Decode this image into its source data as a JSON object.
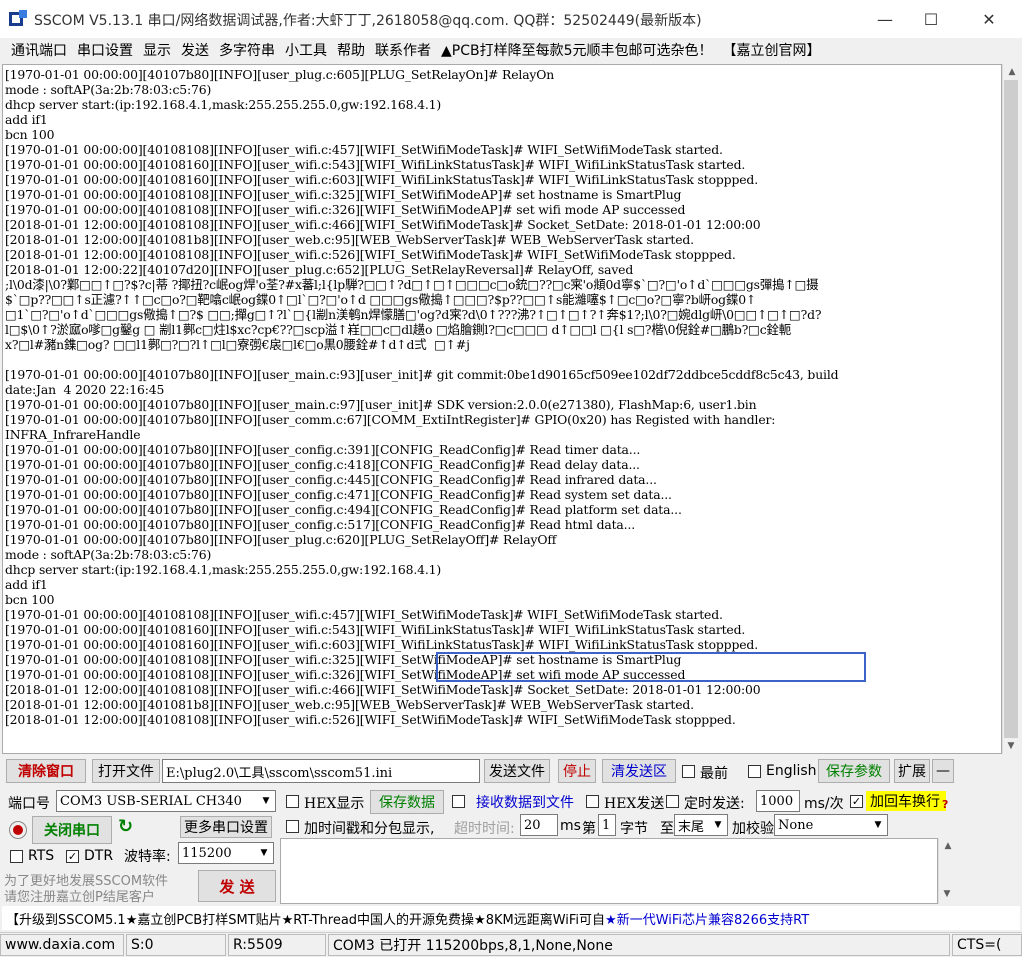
{
  "window": {
    "title": "SSCOM V5.13.1 串口/网络数据调试器,作者:大虾丁丁,2618058@qq.com. QQ群：52502449(最新版本)",
    "minimize_glyph": "—",
    "maximize_glyph": "☐",
    "close_glyph": "✕"
  },
  "menu": {
    "items": [
      "通讯端口",
      "串口设置",
      "显示",
      "发送",
      "多字符串",
      "小工具",
      "帮助",
      "联系作者",
      "▲PCB打样降至每款5元顺丰包邮可选杂色！",
      "【嘉立创官网】"
    ]
  },
  "terminal": {
    "lines": [
      "[1970-01-01 00:00:00][40107b80][INFO][user_plug.c:605][PLUG_SetRelayOn]# RelayOn",
      "mode : softAP(3a:2b:78:03:c5:76)",
      "dhcp server start:(ip:192.168.4.1,mask:255.255.255.0,gw:192.168.4.1)",
      "add if1",
      "bcn 100",
      "[1970-01-01 00:00:00][40108108][INFO][user_wifi.c:457][WIFI_SetWifiModeTask]# WIFI_SetWifiModeTask started.",
      "[1970-01-01 00:00:00][40108160][INFO][user_wifi.c:543][WIFI_WifiLinkStatusTask]# WIFI_WifiLinkStatusTask started.",
      "[1970-01-01 00:00:00][40108160][INFO][user_wifi.c:603][WIFI_WifiLinkStatusTask]# WIFI_WifiLinkStatusTask stoppped.",
      "[1970-01-01 00:00:00][40108108][INFO][user_wifi.c:325][WIFI_SetWifiModeAP]# set hostname is SmartPlug",
      "[1970-01-01 00:00:00][40108108][INFO][user_wifi.c:326][WIFI_SetWifiModeAP]# set wifi mode AP successed",
      "[2018-01-01 12:00:00][40108108][INFO][user_wifi.c:466][WIFI_SetWifiModeTask]# Socket_SetDate: 2018-01-01 12:00:00",
      "[2018-01-01 12:00:00][401081b8][INFO][user_web.c:95][WEB_WebServerTask]# WEB_WebServerTask started.",
      "[2018-01-01 12:00:00][40108108][INFO][user_wifi.c:526][WIFI_SetWifiModeTask]# WIFI_SetWifiModeTask stoppped.",
      "[2018-01-01 12:00:22][40107d20][INFO][user_plug.c:652][PLUG_SetRelayReversal]# RelayOff, saved",
      ";l\\0d漆|\\0?鄴□□↑□?$?c|蒂 ?揶扭?c岷og焊'o荃?#x蕃l;l{lp騨?□□↑?d□↑□↑□□□c□o銃□??□c宷'o頫0d寧$`□?□'o↑d`□□□gs彈搗↑□摄",
      "$`□p??□□↑s正濾?↑↑□c□o?□靶噏c岷og鍱0↑□l`□?□'o↑d □□□gs儆搗↑□□□?$p??□□↑s能濰噻$↑□c□o?□寧?b岍og鍱0↑",
      "□1`□?□'o↑d`□□□gs儆搗↑□?$ □□;撣g□↑?l`□{l剬n渼鹌n焊懞膳□'og?d宷?d\\0↑???沸?↑□↑□↑?↑奔$1?;l\\0?□婉dlg岍\\0□□↑□↑□?d?",
      "l□$\\0↑?淤寙o嗲□g鑿g □ 剬l1鄸c□炷l$xc?cp€??□scp溢↑嵀□□c□dl趪o □焰膾鍘l?□c□□□ d↑□□l □{l s□?楷\\0倪銓#□鵬b?□c銓軛",
      "x?□l#瀦n鏶□og? □□l1鄸□?□?l↑□l□寮彅€扆□l€□o黒0腰銓#↑d↑d弍  □↑#j",
      "",
      "[1970-01-01 00:00:00][40107b80][INFO][user_main.c:93][user_init]# git commit:0be1d90165cf509ee102df72ddbce5cddf8c5c43, build",
      "date:Jan  4 2020 22:16:45",
      "[1970-01-01 00:00:00][40107b80][INFO][user_main.c:97][user_init]# SDK version:2.0.0(e271380), FlashMap:6, user1.bin",
      "[1970-01-01 00:00:00][40107b80][INFO][user_comm.c:67][COMM_ExtiIntRegister]# GPIO(0x20) has Registed with handler:",
      "INFRA_InfrareHandle",
      "[1970-01-01 00:00:00][40107b80][INFO][user_config.c:391][CONFIG_ReadConfig]# Read timer data...",
      "[1970-01-01 00:00:00][40107b80][INFO][user_config.c:418][CONFIG_ReadConfig]# Read delay data...",
      "[1970-01-01 00:00:00][40107b80][INFO][user_config.c:445][CONFIG_ReadConfig]# Read infrared data...",
      "[1970-01-01 00:00:00][40107b80][INFO][user_config.c:471][CONFIG_ReadConfig]# Read system set data...",
      "[1970-01-01 00:00:00][40107b80][INFO][user_config.c:494][CONFIG_ReadConfig]# Read platform set data...",
      "[1970-01-01 00:00:00][40107b80][INFO][user_config.c:517][CONFIG_ReadConfig]# Read html data...",
      "[1970-01-01 00:00:00][40107b80][INFO][user_plug.c:620][PLUG_SetRelayOff]# RelayOff",
      "mode : softAP(3a:2b:78:03:c5:76)",
      "dhcp server start:(ip:192.168.4.1,mask:255.255.255.0,gw:192.168.4.1)",
      "add if1",
      "bcn 100",
      "[1970-01-01 00:00:00][40108108][INFO][user_wifi.c:457][WIFI_SetWifiModeTask]# WIFI_SetWifiModeTask started.",
      "[1970-01-01 00:00:00][40108160][INFO][user_wifi.c:543][WIFI_WifiLinkStatusTask]# WIFI_WifiLinkStatusTask started.",
      "[1970-01-01 00:00:00][40108160][INFO][user_wifi.c:603][WIFI_WifiLinkStatusTask]# WIFI_WifiLinkStatusTask stoppped.",
      "[1970-01-01 00:00:00][40108108][INFO][user_wifi.c:325][WIFI_SetWifiModeAP]# set hostname is SmartPlug",
      "[1970-01-01 00:00:00][40108108][INFO][user_wifi.c:326][WIFI_SetWifiModeAP]# set wifi mode AP successed",
      "[2018-01-01 12:00:00][40108108][INFO][user_wifi.c:466][WIFI_SetWifiModeTask]# Socket_SetDate: 2018-01-01 12:00:00",
      "[2018-01-01 12:00:00][401081b8][INFO][user_web.c:95][WEB_WebServerTask]# WEB_WebServerTask started.",
      "[2018-01-01 12:00:00][40108108][INFO][user_wifi.c:526][WIFI_SetWifiModeTask]# WIFI_SetWifiModeTask stoppped."
    ]
  },
  "toolbar1": {
    "clear_window": "清除窗口",
    "open_file": "打开文件",
    "file_path": "E:\\plug2.0\\工具\\sscom\\sscom51.ini",
    "send_file": "发送文件",
    "stop": "停止",
    "clear_send": "清发送区",
    "topmost": "最前",
    "english": "English",
    "save_params": "保存参数",
    "expand": "扩展",
    "collapse": "—"
  },
  "toolbar2": {
    "port_label": "端口号",
    "port_value": "COM3 USB-SERIAL CH340",
    "hex_display": "HEX显示",
    "save_data": "保存数据",
    "receive_to_file": "接收数据到文件",
    "hex_send": "HEX发送",
    "timed_send": "定时发送:",
    "interval_value": "1000",
    "interval_unit": "ms/次",
    "append_crlf": "加回车换行",
    "help_mark": "?"
  },
  "toolbar3": {
    "close_port": "关闭串口",
    "refresh_glyph": "↻",
    "more_settings": "更多串口设置",
    "timestamp_label": "加时间戳和分包显示,",
    "timeout_label": "超时时间:",
    "timeout_value": "20",
    "timeout_unit": "ms",
    "byte_index_label": "第",
    "byte_index_value": "1",
    "byte_label": "字节",
    "to_label": "至",
    "end_value": "末尾",
    "checksum_label": "加校验",
    "checksum_value": "None"
  },
  "toolbar4": {
    "rts": "RTS",
    "dtr": "DTR",
    "baud_label": "波特率:",
    "baud_value": "115200"
  },
  "promo": {
    "line1": "为了更好地发展SSCOM软件",
    "line2": "请您注册嘉立创P结尾客户",
    "send_button": "发  送"
  },
  "adbar": {
    "text_black": "【升级到SSCOM5.1★嘉立创PCB打样SMT贴片★RT-Thread中国人的开源免费操★8KM远距离WiFi可自",
    "text_blue": "★新一代WiFi芯片兼容8266支持RT"
  },
  "status": {
    "website": "www.daxia.com",
    "sent": "S:0",
    "received": "R:5509",
    "port_state": "COM3 已打开  115200bps,8,1,None,None",
    "cts": "CTS=("
  },
  "colors": {
    "highlight_box": "#3c64c8",
    "red_text": "#c00000",
    "green_text": "#008000",
    "blue_text": "#0000d0",
    "yellow_bg": "#ffff00"
  }
}
